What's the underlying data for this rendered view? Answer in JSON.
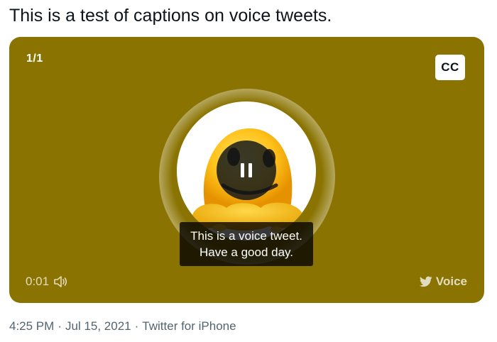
{
  "tweet": {
    "text": "This is a test of captions on voice tweets."
  },
  "media": {
    "counter": "1/1",
    "cc_label": "CC",
    "caption_line_1": "This is a voice tweet.",
    "caption_line_2": "Have a good day.",
    "elapsed": "0:01",
    "voice_label": "Voice",
    "background_color": "#8a7300",
    "icons": {
      "center": "melting-face-emoji-icon",
      "play_state": "pause-icon",
      "audio": "speaker-icon",
      "brand": "twitter-bird-icon"
    }
  },
  "meta": {
    "time": "4:25 PM",
    "date": "Jul 15, 2021",
    "source": "Twitter for iPhone",
    "separator": "·"
  }
}
